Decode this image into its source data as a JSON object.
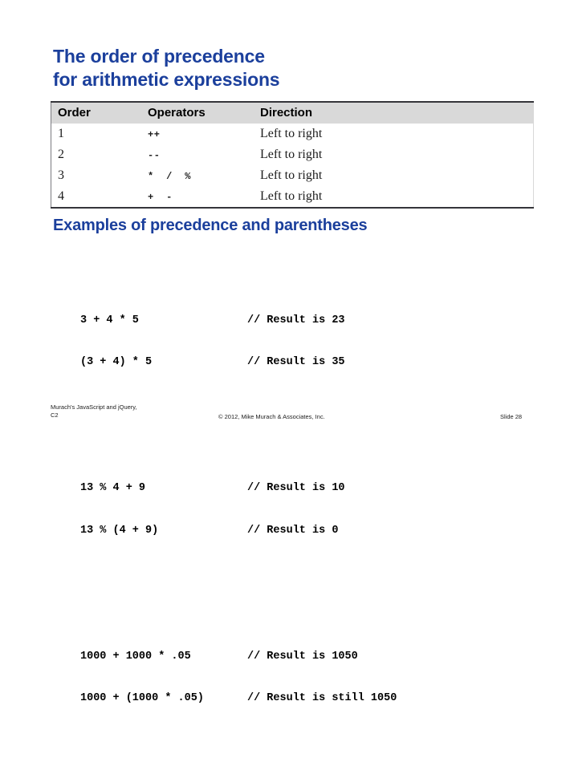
{
  "title": {
    "line1": "The order of precedence",
    "line2": "for arithmetic expressions",
    "color": "#1b3f9c"
  },
  "table": {
    "headers": {
      "order": "Order",
      "operators": "Operators",
      "direction": "Direction"
    },
    "header_background": "#d9d9d9",
    "rows": [
      {
        "order": "1",
        "operators": "++",
        "direction": "Left to right"
      },
      {
        "order": "2",
        "operators": "--",
        "direction": "Left to right"
      },
      {
        "order": "3",
        "operators": "*  /  %",
        "direction": "Left to right"
      },
      {
        "order": "4",
        "operators": "+  -",
        "direction": "Left to right"
      }
    ]
  },
  "examples": {
    "heading": "Examples of precedence and parentheses",
    "groups": [
      {
        "lines": [
          {
            "expr": "3 + 4 * 5",
            "comment": "// Result is 23"
          },
          {
            "expr": "(3 + 4) * 5",
            "comment": "// Result is 35"
          }
        ]
      },
      {
        "lines": [
          {
            "expr": "13 % 4 + 9",
            "comment": "// Result is 10"
          },
          {
            "expr": "13 % (4 + 9)",
            "comment": "// Result is 0"
          }
        ]
      },
      {
        "lines": [
          {
            "expr": "1000 + 1000 * .05",
            "comment": "// Result is 1050"
          },
          {
            "expr": "1000 + (1000 * .05)",
            "comment": "// Result is still 1050"
          }
        ]
      }
    ]
  },
  "footer": {
    "left_line1": "Murach's JavaScript and jQuery,",
    "left_line2": "C2",
    "copyright": "© 2012, Mike Murach & Associates, Inc.",
    "slide_number": "Slide 28"
  }
}
